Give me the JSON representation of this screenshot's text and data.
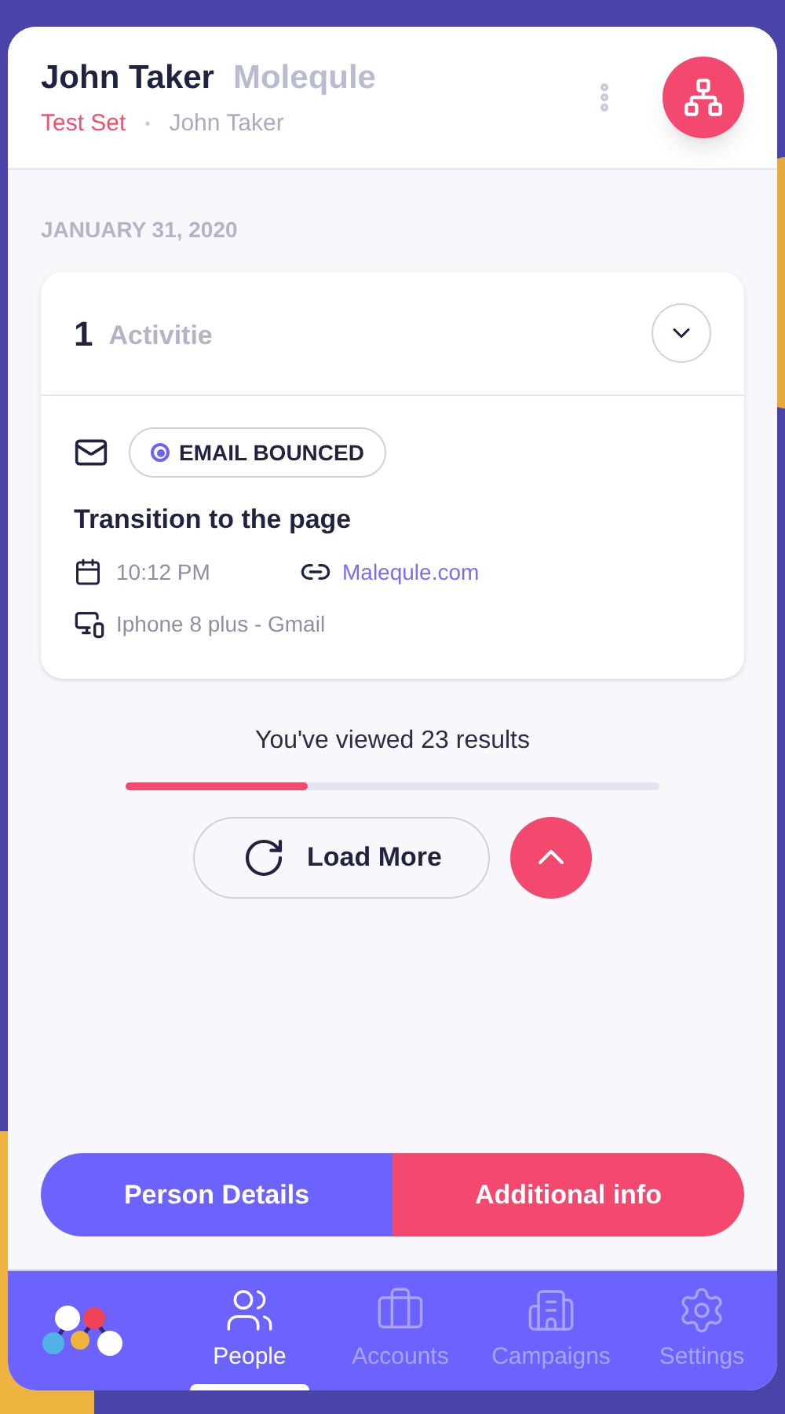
{
  "header": {
    "name": "John Taker",
    "company": "Molequle",
    "set": "Test Set",
    "separator": "•",
    "owner": "John Taker"
  },
  "date": "JANUARY 31, 2020",
  "activities": {
    "count": "1",
    "label": "Activitie",
    "expanded": true,
    "item": {
      "status": "EMAIL BOUNCED",
      "title": "Transition to the page",
      "time": "10:12 PM",
      "link": "Malequle.com",
      "device": "Iphone 8 plus - Gmail"
    }
  },
  "progress": {
    "text": "You've viewed 23 results",
    "level": 0.34
  },
  "load_more": "Load More",
  "tabs": [
    {
      "label": "Person Details",
      "selected": false
    },
    {
      "label": "Additional info",
      "selected": true
    }
  ],
  "nav": [
    {
      "kind": "people",
      "label": "People",
      "selected": true
    },
    {
      "kind": "accounts",
      "label": "Accounts",
      "selected": false
    },
    {
      "kind": "campaigns",
      "label": "Campaigns",
      "selected": false
    },
    {
      "kind": "settings",
      "label": "Settings",
      "selected": false
    }
  ]
}
